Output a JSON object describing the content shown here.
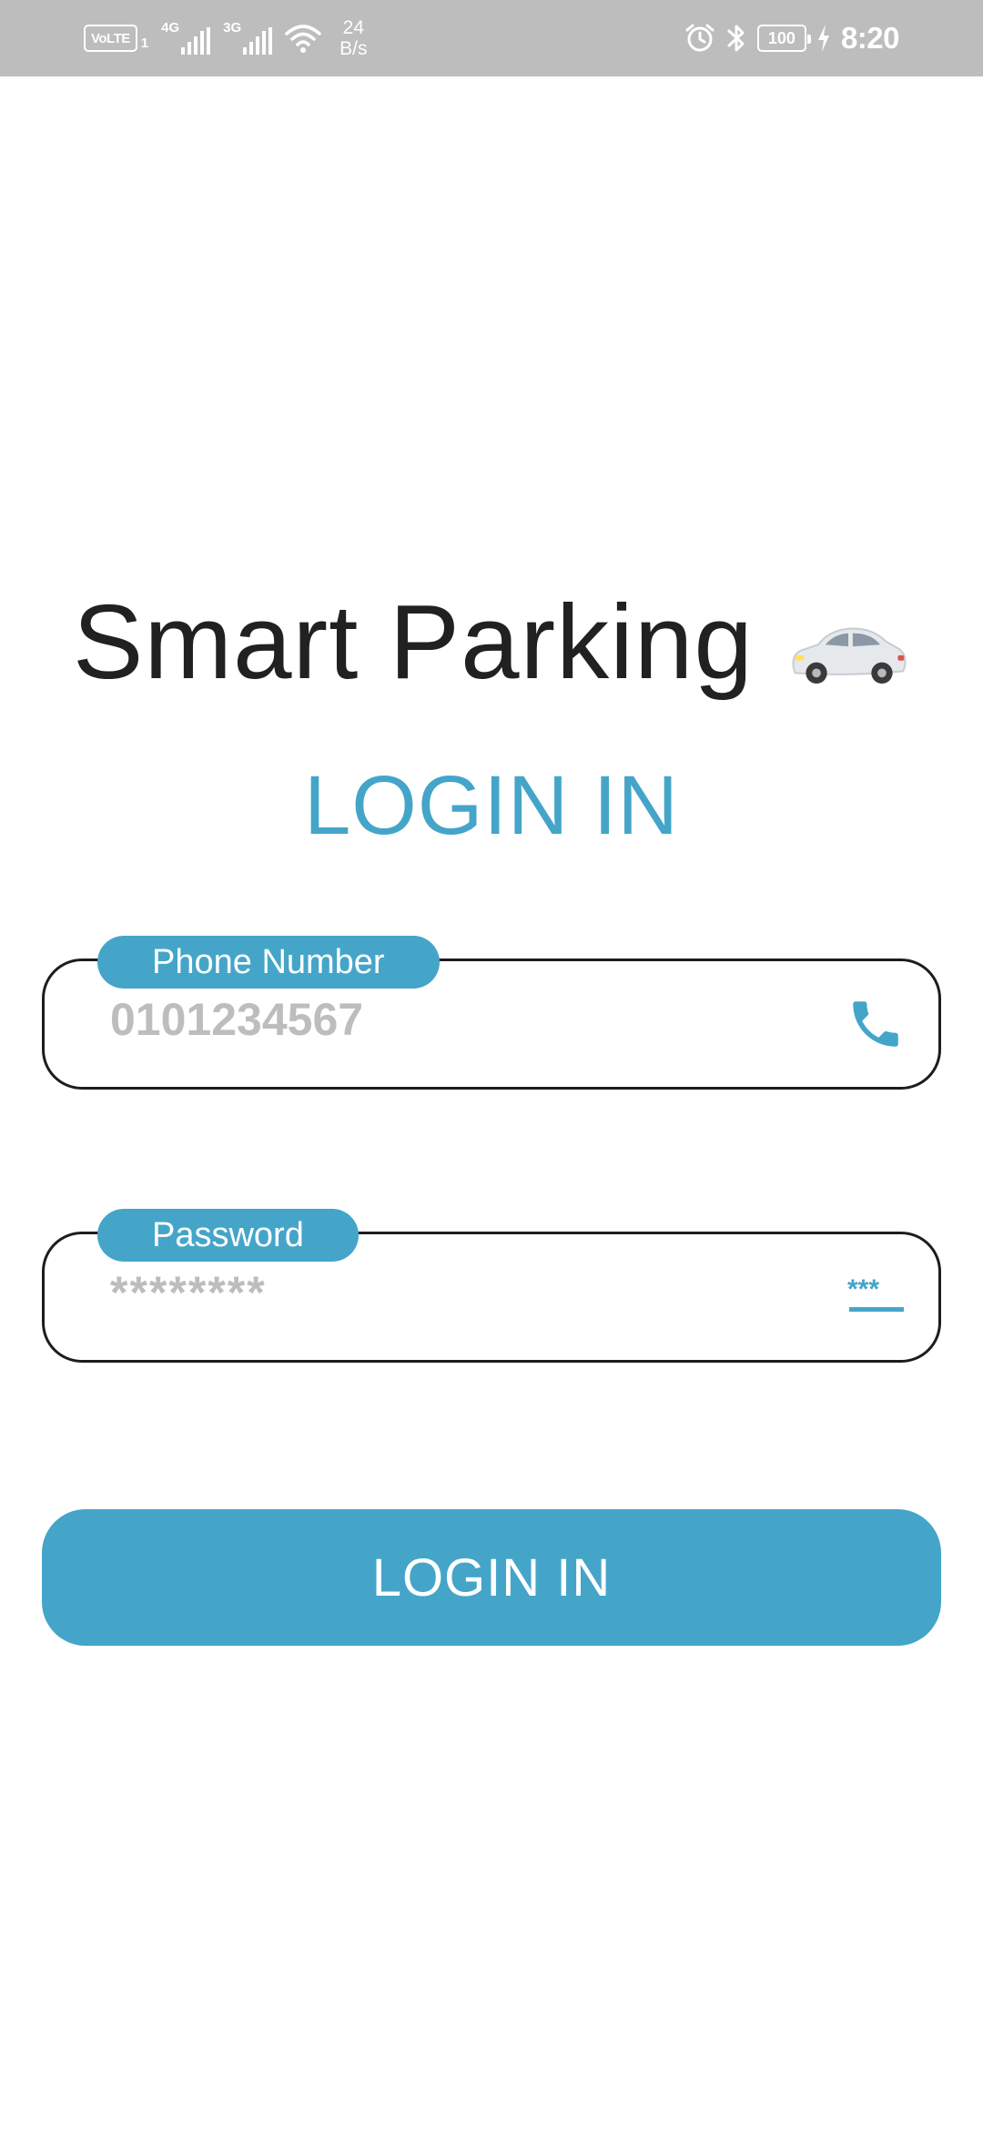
{
  "status_bar": {
    "volte": "VoLTE",
    "sim_slot": "1",
    "network_1": "4G",
    "network_2": "3G",
    "speed_value": "24",
    "speed_unit": "B/s",
    "battery": "100",
    "time": "8:20"
  },
  "app": {
    "title": "Smart Parking",
    "title_icon": "car-icon",
    "heading": "LOGIN IN"
  },
  "form": {
    "phone": {
      "label": "Phone Number",
      "placeholder": "0101234567",
      "value": "",
      "icon": "phone-icon"
    },
    "password": {
      "label": "Password",
      "placeholder": "********",
      "value": "",
      "icon": "password-icon"
    },
    "submit_label": "LOGIN IN"
  },
  "colors": {
    "accent": "#44a5c9",
    "status_bar": "#bdbdbd",
    "title_text": "#212121",
    "field_border": "#1d1d1d",
    "placeholder": "#bdbdbd"
  }
}
